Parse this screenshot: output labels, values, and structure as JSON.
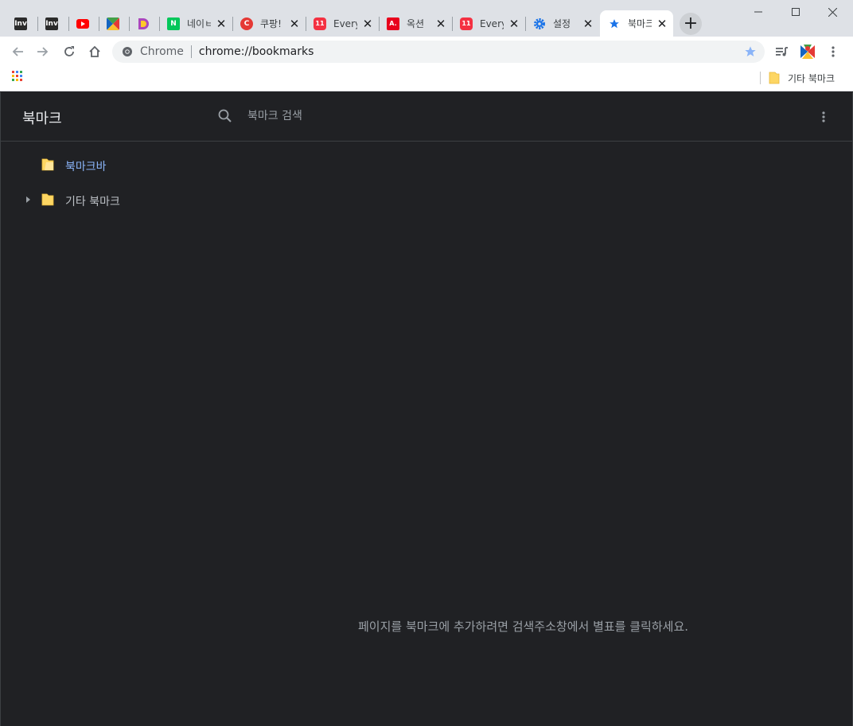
{
  "tabs": [
    {
      "title": "",
      "favicon": "Inv",
      "color": "#2b2b2b",
      "left": 0
    },
    {
      "title": "",
      "favicon": "Inv",
      "color": "#2b2b2b"
    },
    {
      "title": "",
      "favicon": "youtube-icon",
      "color": "#ff0000"
    },
    {
      "title": "",
      "favicon": "cross-logo-icon",
      "color": "#ffffff"
    },
    {
      "title": "",
      "favicon": "d-logo-icon",
      "color": "#ffffff"
    },
    {
      "title": "네이ㅂ",
      "favicon": "N",
      "color": "#03c75a"
    },
    {
      "title": "쿠팡!",
      "favicon": "C",
      "color": "#e53935"
    },
    {
      "title": "Every",
      "favicon": "11",
      "color": "#f43142"
    },
    {
      "title": "옥션",
      "favicon": "A.",
      "color": "#e8001c"
    },
    {
      "title": "Every",
      "favicon": "11",
      "color": "#f43142"
    },
    {
      "title": "설정",
      "favicon": "gear-icon",
      "color": "#1a73e8"
    },
    {
      "title": "북마크",
      "favicon": "star-icon",
      "color": "#1a73e8",
      "active": true
    }
  ],
  "omnibox": {
    "chip": "Chrome",
    "url": "chrome://bookmarks"
  },
  "bookmarks_bar": {
    "other_label": "기타 북마크"
  },
  "manager": {
    "title": "북마크",
    "search_placeholder": "북마크 검색",
    "tree": [
      {
        "label": "북마크바",
        "selected": true,
        "expandable": false
      },
      {
        "label": "기타 북마크",
        "selected": false,
        "expandable": true
      }
    ],
    "empty_message": "페이지를 북마크에 추가하려면 검색주소창에서 별표를 클릭하세요."
  },
  "colors": {
    "accent": "#8ab4f8",
    "page_bg": "#202124",
    "folder": "#fdd663"
  }
}
